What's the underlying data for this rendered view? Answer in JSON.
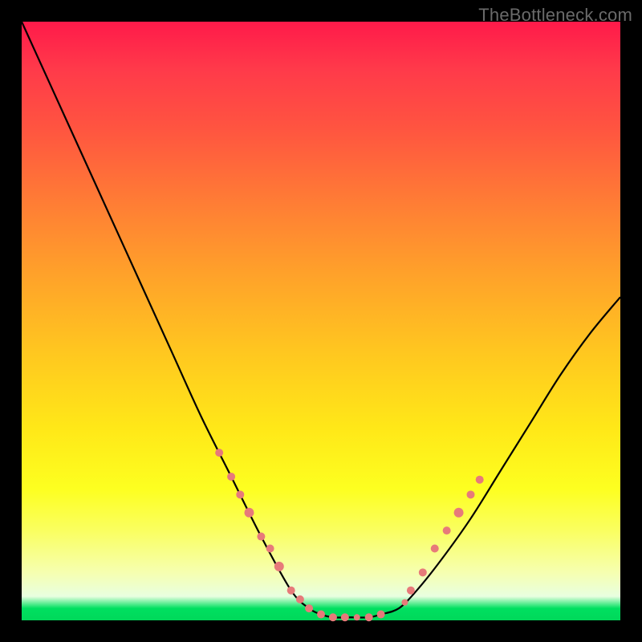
{
  "watermark": "TheBottleneck.com",
  "chart_data": {
    "type": "line",
    "title": "",
    "xlabel": "",
    "ylabel": "",
    "xlim": [
      0,
      100
    ],
    "ylim": [
      0,
      100
    ],
    "series": [
      {
        "name": "bottleneck-curve",
        "x": [
          0,
          5,
          10,
          15,
          20,
          25,
          30,
          35,
          40,
          45,
          48,
          50,
          52,
          55,
          58,
          60,
          63,
          66,
          70,
          75,
          80,
          85,
          90,
          95,
          100
        ],
        "y": [
          100,
          89,
          78,
          67,
          56,
          45,
          34,
          24,
          14,
          5,
          2,
          1,
          0.5,
          0.5,
          0.5,
          1,
          2,
          5,
          10,
          17,
          25,
          33,
          41,
          48,
          54
        ]
      }
    ],
    "markers": {
      "name": "highlighted-points",
      "color": "#e77a7a",
      "points": [
        {
          "x": 33,
          "y": 28,
          "r": 5
        },
        {
          "x": 35,
          "y": 24,
          "r": 5
        },
        {
          "x": 36.5,
          "y": 21,
          "r": 5
        },
        {
          "x": 38,
          "y": 18,
          "r": 6
        },
        {
          "x": 40,
          "y": 14,
          "r": 5
        },
        {
          "x": 41.5,
          "y": 12,
          "r": 5
        },
        {
          "x": 43,
          "y": 9,
          "r": 6
        },
        {
          "x": 45,
          "y": 5,
          "r": 5
        },
        {
          "x": 46.5,
          "y": 3.5,
          "r": 5
        },
        {
          "x": 48,
          "y": 2,
          "r": 5
        },
        {
          "x": 50,
          "y": 1,
          "r": 5
        },
        {
          "x": 52,
          "y": 0.5,
          "r": 5
        },
        {
          "x": 54,
          "y": 0.5,
          "r": 5
        },
        {
          "x": 56,
          "y": 0.5,
          "r": 4
        },
        {
          "x": 58,
          "y": 0.5,
          "r": 5
        },
        {
          "x": 60,
          "y": 1,
          "r": 5
        },
        {
          "x": 64,
          "y": 3,
          "r": 4
        },
        {
          "x": 65,
          "y": 5,
          "r": 5
        },
        {
          "x": 67,
          "y": 8,
          "r": 5
        },
        {
          "x": 69,
          "y": 12,
          "r": 5
        },
        {
          "x": 71,
          "y": 15,
          "r": 5
        },
        {
          "x": 73,
          "y": 18,
          "r": 6
        },
        {
          "x": 75,
          "y": 21,
          "r": 5
        },
        {
          "x": 76.5,
          "y": 23.5,
          "r": 5
        }
      ]
    }
  }
}
